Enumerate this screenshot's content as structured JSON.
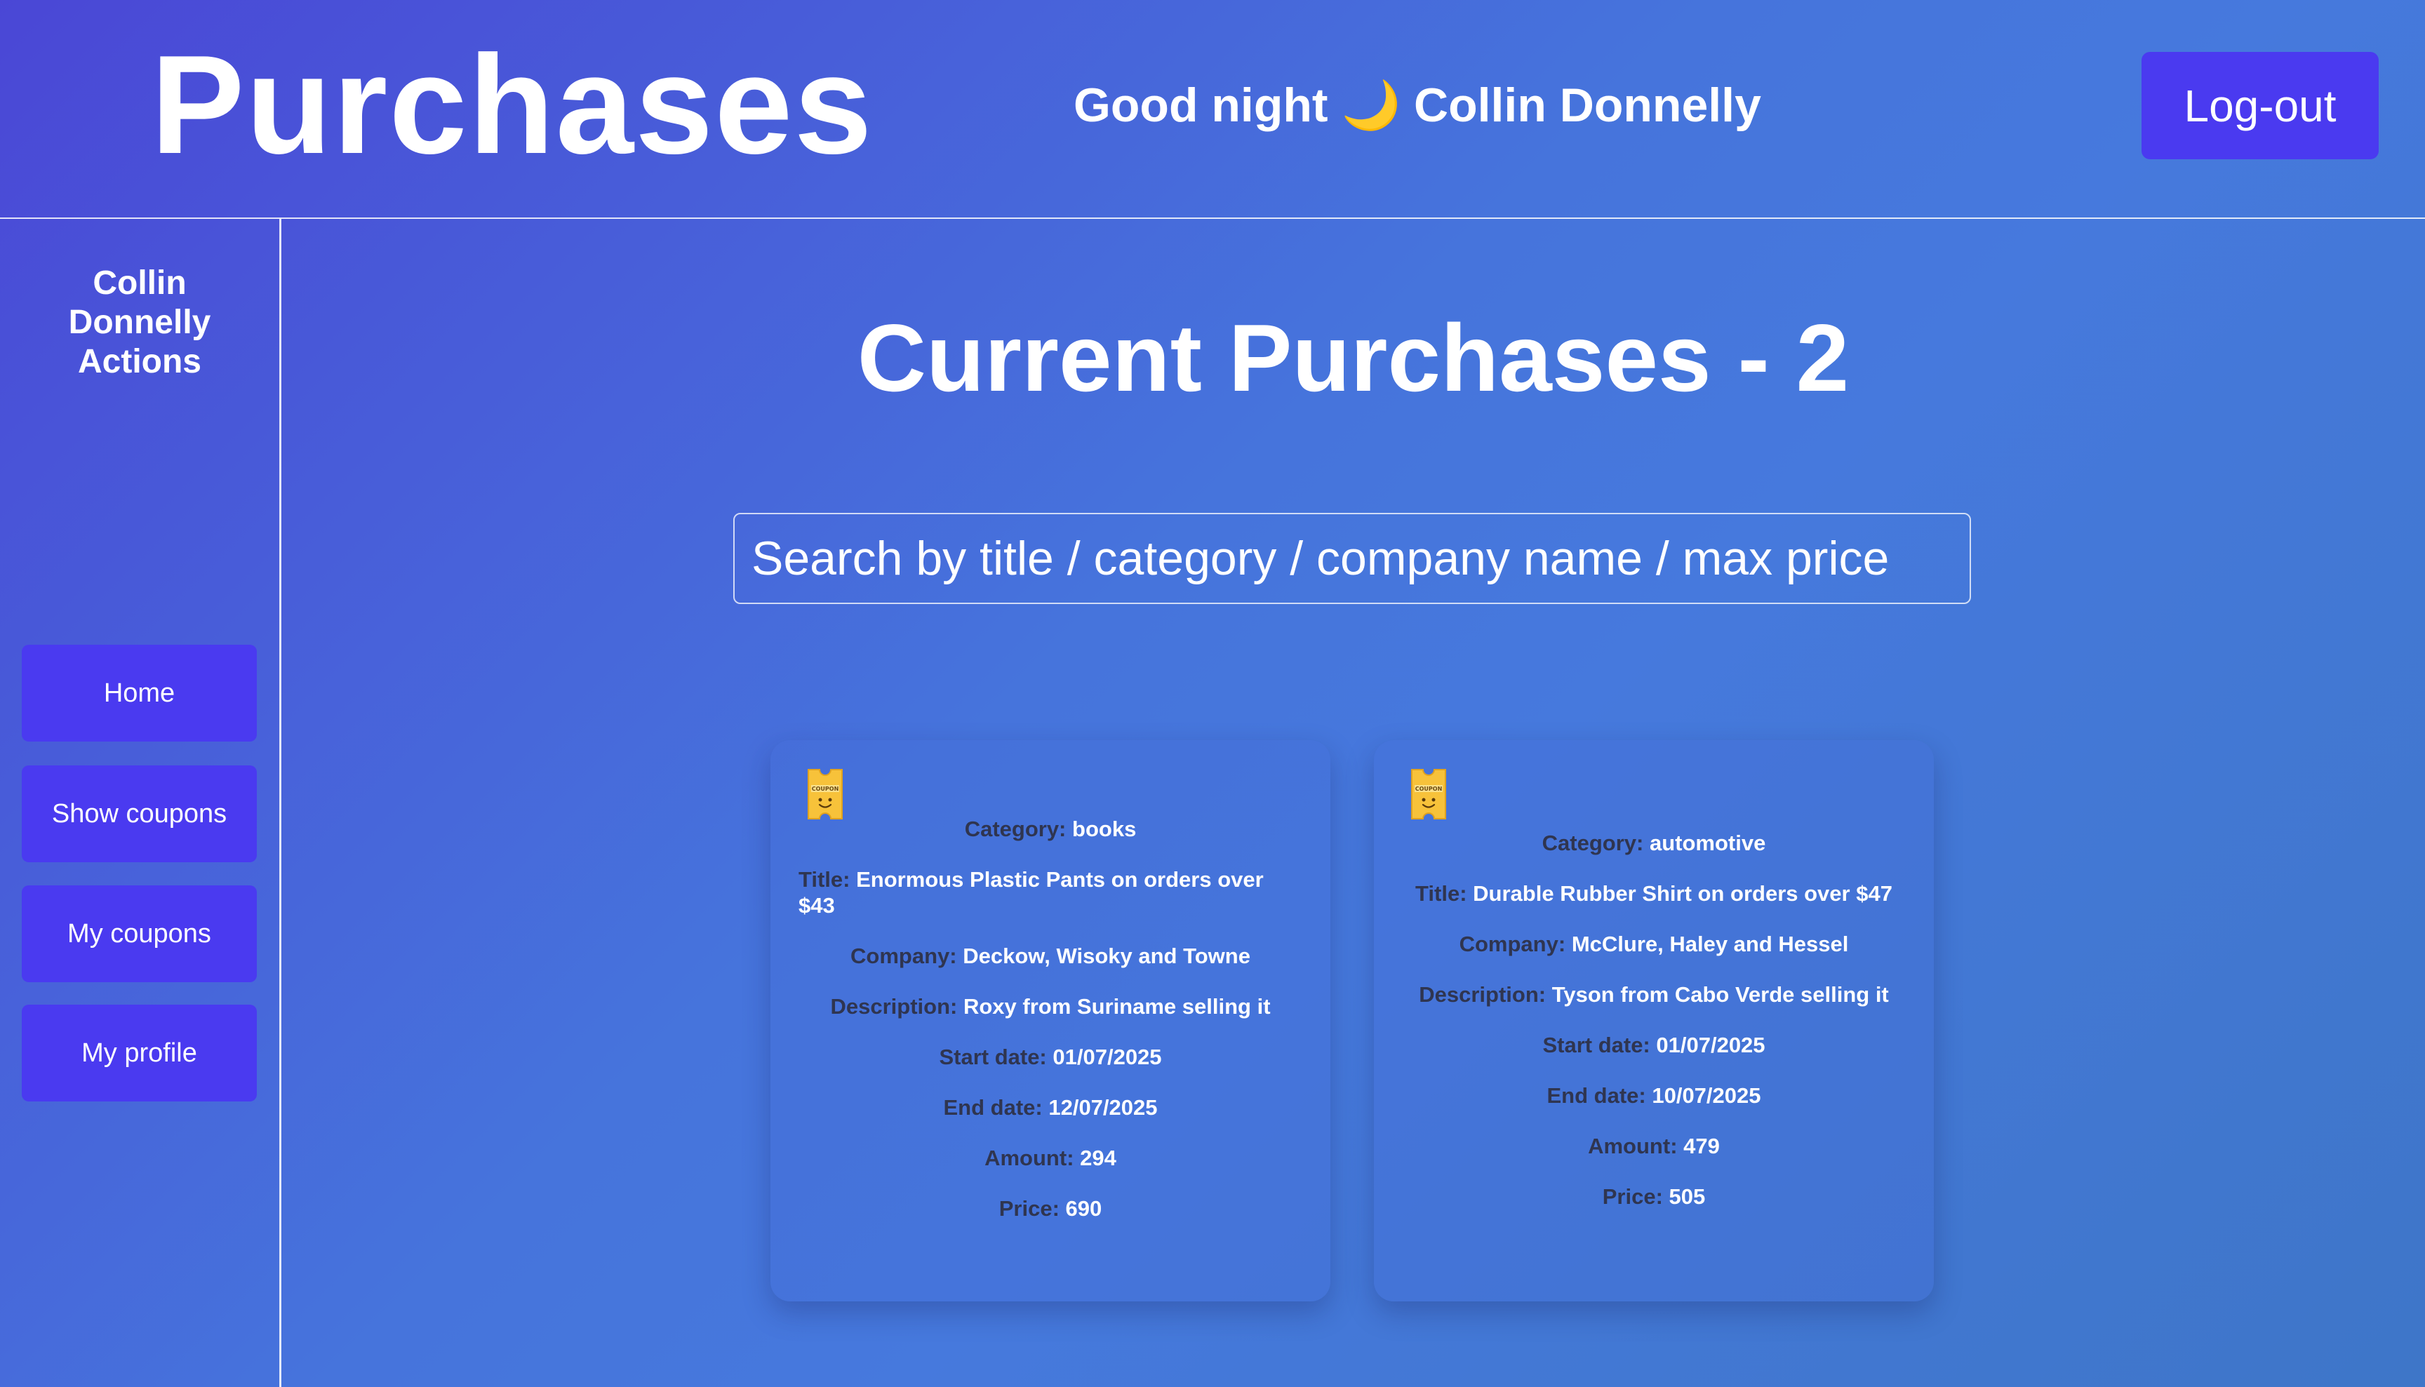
{
  "header": {
    "title": "Purchases",
    "greeting": "Good night 🌙 Collin Donnelly",
    "logout_label": "Log-out"
  },
  "sidebar": {
    "title": "Collin Donnelly Actions",
    "items": [
      {
        "label": "Home"
      },
      {
        "label": "Show coupons"
      },
      {
        "label": "My coupons"
      },
      {
        "label": "My profile"
      }
    ]
  },
  "main": {
    "title": "Current Purchases - 2",
    "search": {
      "value": "",
      "placeholder": "Search by title / category / company name / max price"
    }
  },
  "labels": {
    "category": "Category:",
    "title": "Title:",
    "company": "Company:",
    "description": "Description:",
    "start_date": "Start date:",
    "end_date": "End date:",
    "amount": "Amount:",
    "price": "Price:"
  },
  "icons": {
    "coupon": "coupon-icon",
    "moon": "moon-icon"
  },
  "colors": {
    "button": "#4a3af0",
    "label_text": "#2f3550",
    "coupon_icon": "#f7c23a"
  },
  "coupons": [
    {
      "category": "books",
      "title": "Enormous Plastic Pants on orders over $43",
      "company": "Deckow, Wisoky and Towne",
      "description": "Roxy from Suriname selling it",
      "start_date": "01/07/2025",
      "end_date": "12/07/2025",
      "amount": "294",
      "price": "690"
    },
    {
      "category": "automotive",
      "title": "Durable Rubber Shirt on orders over $47",
      "company": "McClure, Haley and Hessel",
      "description": "Tyson from Cabo Verde selling it",
      "start_date": "01/07/2025",
      "end_date": "10/07/2025",
      "amount": "479",
      "price": "505"
    }
  ]
}
